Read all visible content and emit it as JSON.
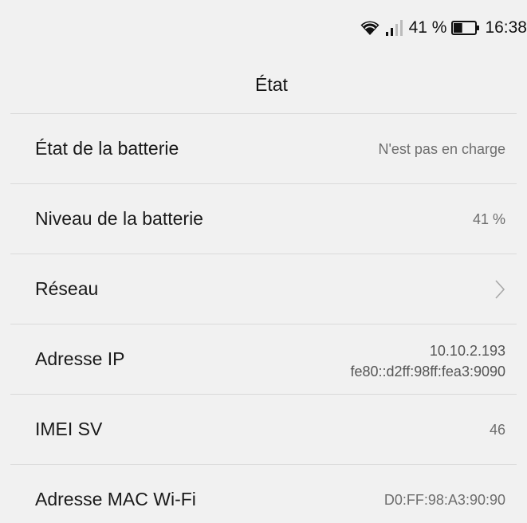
{
  "status_bar": {
    "battery_percent": "41 %",
    "time": "16:38",
    "battery_level": 0.41,
    "wifi_icon": "wifi-icon",
    "signal_icon": "signal-icon",
    "battery_icon": "battery-icon"
  },
  "header": {
    "title": "État"
  },
  "rows": {
    "battery_state": {
      "label": "État de la batterie",
      "value": "N'est pas en charge"
    },
    "battery_level": {
      "label": "Niveau de la batterie",
      "value": "41 %"
    },
    "network": {
      "label": "Réseau",
      "icon": "chevron-right-icon"
    },
    "ip_address": {
      "label": "Adresse IP",
      "value_ipv4": "10.10.2.193",
      "value_ipv6": "fe80::d2ff:98ff:fea3:9090"
    },
    "imei_sv": {
      "label": "IMEI SV",
      "value": "46"
    },
    "wifi_mac": {
      "label": "Adresse MAC Wi-Fi",
      "value": "D0:FF:98:A3:90:90"
    }
  }
}
